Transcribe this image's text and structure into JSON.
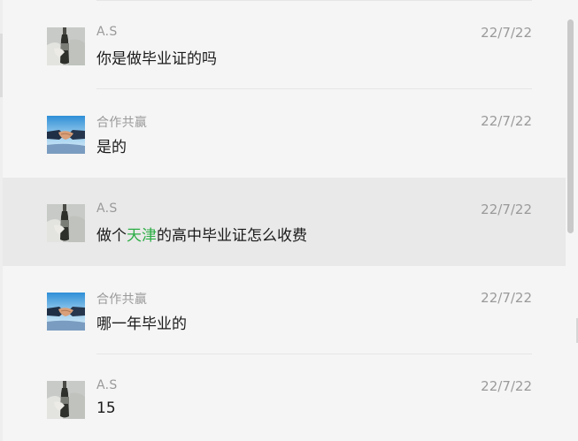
{
  "messages": [
    {
      "sender": "A.S",
      "time": "22/7/22",
      "text": "你是做毕业证的吗",
      "avatar_icon": "bottle-avatar-icon"
    },
    {
      "sender": "合作共赢",
      "time": "22/7/22",
      "text": "是的",
      "avatar_icon": "handshake-avatar-icon"
    },
    {
      "sender": "A.S",
      "time": "22/7/22",
      "text_before": "做个",
      "text_highlight": "天津",
      "text_after": "的高中毕业证怎么收费",
      "highlight_color": "#2bad44",
      "avatar_icon": "bottle-avatar-icon",
      "selected": true
    },
    {
      "sender": "合作共赢",
      "time": "22/7/22",
      "text": "哪一年毕业的",
      "avatar_icon": "handshake-avatar-icon"
    },
    {
      "sender": "A.S",
      "time": "22/7/22",
      "text": "15",
      "avatar_icon": "bottle-avatar-icon"
    }
  ],
  "colors": {
    "background": "#f5f5f5",
    "selected_row": "#e9e9e9",
    "muted_text": "#9a9a9a",
    "highlight": "#2bad44"
  }
}
